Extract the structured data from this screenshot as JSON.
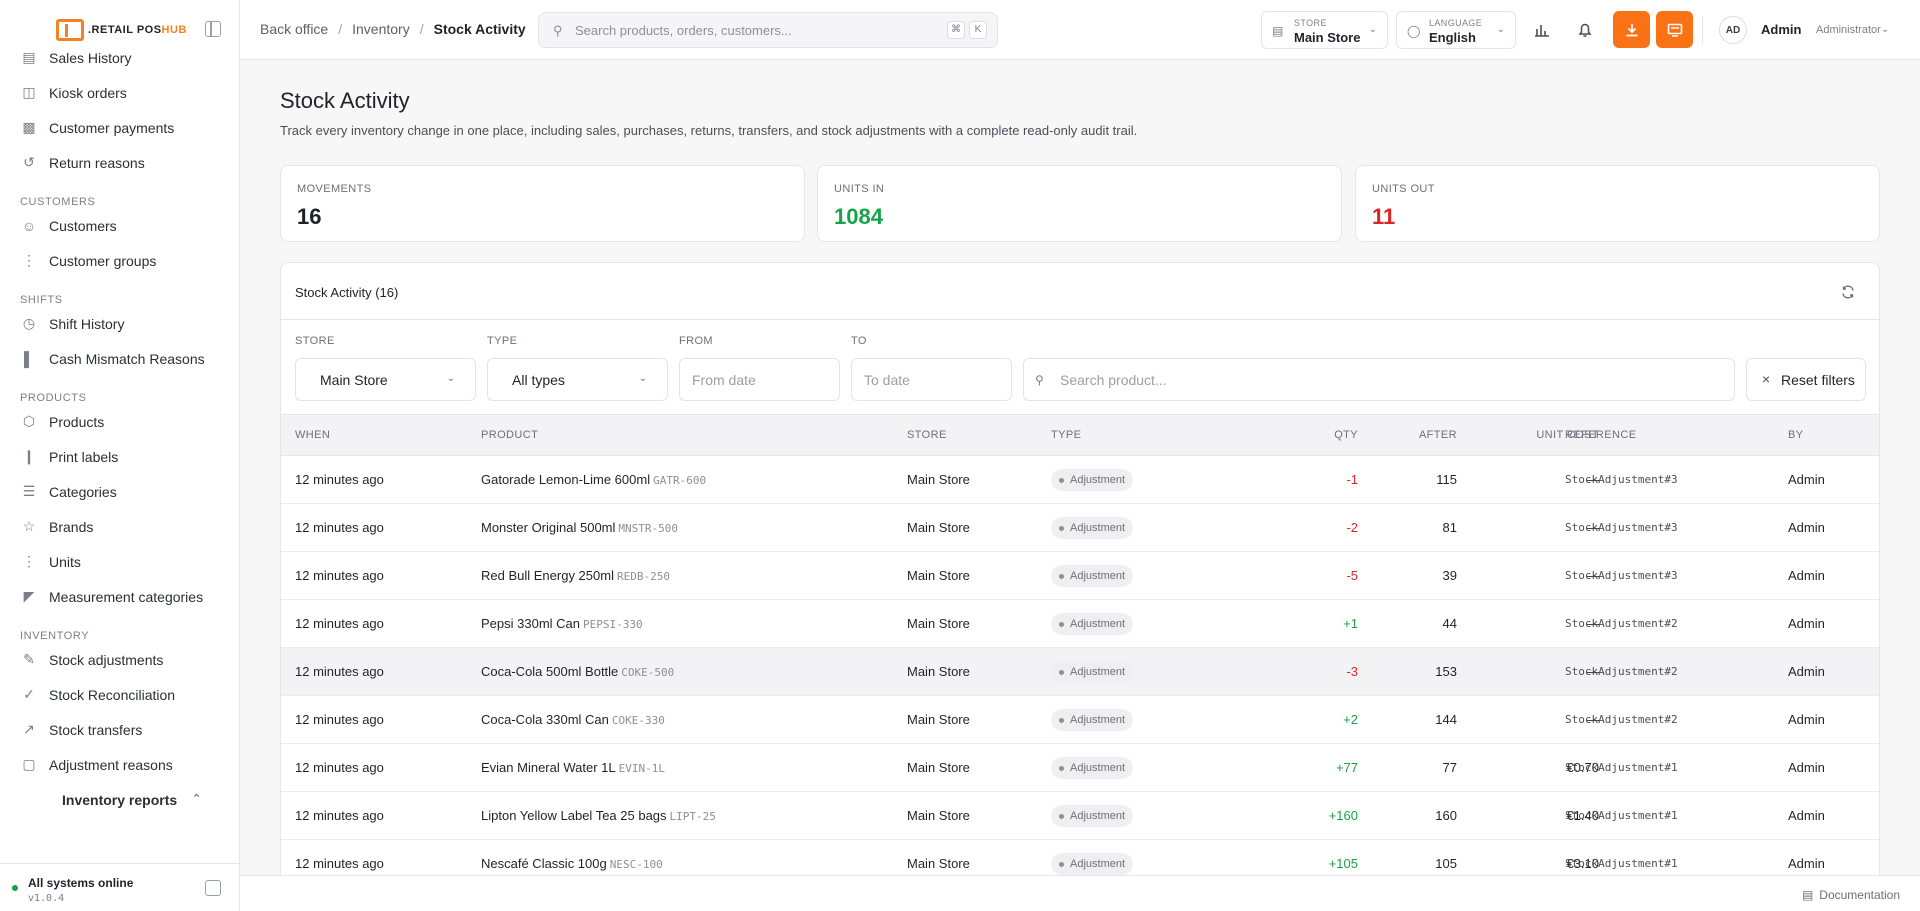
{
  "app": {
    "logo_prefix": ".RETAIL POS",
    "logo_suffix": "HUB"
  },
  "sidebar": {
    "items_top": [
      {
        "label": "Sales History",
        "icon": "receipt-icon"
      },
      {
        "label": "Kiosk orders",
        "icon": "kiosk-icon"
      },
      {
        "label": "Customer payments",
        "icon": "payments-icon"
      },
      {
        "label": "Return reasons",
        "icon": "return-icon"
      }
    ],
    "sections": [
      {
        "title": "CUSTOMERS",
        "items": [
          {
            "label": "Customers",
            "icon": "users-icon"
          },
          {
            "label": "Customer groups",
            "icon": "grip-icon"
          }
        ]
      },
      {
        "title": "SHIFTS",
        "items": [
          {
            "label": "Shift History",
            "icon": "clock-icon"
          },
          {
            "label": "Cash Mismatch Reasons",
            "icon": "bar-chart-icon"
          }
        ]
      },
      {
        "title": "PRODUCTS",
        "items": [
          {
            "label": "Products",
            "icon": "box-icon"
          },
          {
            "label": "Print labels",
            "icon": "barcode-icon"
          },
          {
            "label": "Categories",
            "icon": "tree-icon"
          },
          {
            "label": "Brands",
            "icon": "star-icon"
          },
          {
            "label": "Units",
            "icon": "grip-icon"
          },
          {
            "label": "Measurement categories",
            "icon": "tag-icon"
          }
        ]
      },
      {
        "title": "INVENTORY",
        "items": [
          {
            "label": "Stock adjustments",
            "icon": "edit-icon"
          },
          {
            "label": "Stock Reconciliation",
            "icon": "check-icon"
          },
          {
            "label": "Stock transfers",
            "icon": "external-icon"
          },
          {
            "label": "Adjustment reasons",
            "icon": "note-icon"
          }
        ]
      }
    ],
    "group_label": "Inventory reports",
    "status": "All systems online",
    "version": "v1.0.4"
  },
  "topbar": {
    "breadcrumb": [
      "Back office",
      "Inventory",
      "Stock Activity"
    ],
    "search_placeholder": "Search products, orders, customers...",
    "kbd_1": "⌘",
    "kbd_2": "K",
    "store_label": "STORE",
    "store_value": "Main Store",
    "language_label": "LANGUAGE",
    "language_value": "English",
    "avatar_initials": "AD",
    "user_name": "Admin",
    "user_role": "Administrator"
  },
  "page": {
    "title": "Stock Activity",
    "subtitle": "Track every inventory change in one place, including sales, purchases, returns, transfers, and stock adjustments with a complete read-only audit trail."
  },
  "stats": [
    {
      "label": "MOVEMENTS",
      "value": "16",
      "color": "#1f2328"
    },
    {
      "label": "UNITS IN",
      "value": "1084",
      "color": "#16a34a"
    },
    {
      "label": "UNITS OUT",
      "value": "11",
      "color": "#dc2626"
    }
  ],
  "card": {
    "title": "Stock Activity (16)"
  },
  "filters": {
    "store_label": "STORE",
    "store_value": "Main Store",
    "type_label": "TYPE",
    "type_value": "All types",
    "from_label": "FROM",
    "from_placeholder": "From date",
    "to_label": "TO",
    "to_placeholder": "To date",
    "search_placeholder": "Search product...",
    "reset_label": "Reset filters"
  },
  "table": {
    "columns": [
      "WHEN",
      "PRODUCT",
      "STORE",
      "TYPE",
      "QTY",
      "AFTER",
      "UNIT COST",
      "REFERENCE",
      "BY"
    ],
    "rows": [
      {
        "when": "12 minutes ago",
        "product": "Gatorade Lemon-Lime 600ml",
        "sku": "GATR-600",
        "store": "Main Store",
        "type": "Adjustment",
        "qty": "-1",
        "after": "115",
        "cost": "—",
        "ref": "StockAdjustment#3",
        "by": "Admin"
      },
      {
        "when": "12 minutes ago",
        "product": "Monster Original 500ml",
        "sku": "MNSTR-500",
        "store": "Main Store",
        "type": "Adjustment",
        "qty": "-2",
        "after": "81",
        "cost": "—",
        "ref": "StockAdjustment#3",
        "by": "Admin"
      },
      {
        "when": "12 minutes ago",
        "product": "Red Bull Energy 250ml",
        "sku": "REDB-250",
        "store": "Main Store",
        "type": "Adjustment",
        "qty": "-5",
        "after": "39",
        "cost": "—",
        "ref": "StockAdjustment#3",
        "by": "Admin"
      },
      {
        "when": "12 minutes ago",
        "product": "Pepsi 330ml Can",
        "sku": "PEPSI-330",
        "store": "Main Store",
        "type": "Adjustment",
        "qty": "+1",
        "after": "44",
        "cost": "—",
        "ref": "StockAdjustment#2",
        "by": "Admin"
      },
      {
        "when": "12 minutes ago",
        "product": "Coca-Cola 500ml Bottle",
        "sku": "COKE-500",
        "store": "Main Store",
        "type": "Adjustment",
        "qty": "-3",
        "after": "153",
        "cost": "—",
        "ref": "StockAdjustment#2",
        "by": "Admin"
      },
      {
        "when": "12 minutes ago",
        "product": "Coca-Cola 330ml Can",
        "sku": "COKE-330",
        "store": "Main Store",
        "type": "Adjustment",
        "qty": "+2",
        "after": "144",
        "cost": "—",
        "ref": "StockAdjustment#2",
        "by": "Admin"
      },
      {
        "when": "12 minutes ago",
        "product": "Evian Mineral Water 1L",
        "sku": "EVIN-1L",
        "store": "Main Store",
        "type": "Adjustment",
        "qty": "+77",
        "after": "77",
        "cost": "€0.70",
        "ref": "StockAdjustment#1",
        "by": "Admin"
      },
      {
        "when": "12 minutes ago",
        "product": "Lipton Yellow Label Tea 25 bags",
        "sku": "LIPT-25",
        "store": "Main Store",
        "type": "Adjustment",
        "qty": "+160",
        "after": "160",
        "cost": "€1.40",
        "ref": "StockAdjustment#1",
        "by": "Admin"
      },
      {
        "when": "12 minutes ago",
        "product": "Nescafé Classic 100g",
        "sku": "NESC-100",
        "store": "Main Store",
        "type": "Adjustment",
        "qty": "+105",
        "after": "105",
        "cost": "€3.10",
        "ref": "StockAdjustment#1",
        "by": "Admin"
      }
    ]
  },
  "footer": {
    "doc_label": "Documentation"
  }
}
